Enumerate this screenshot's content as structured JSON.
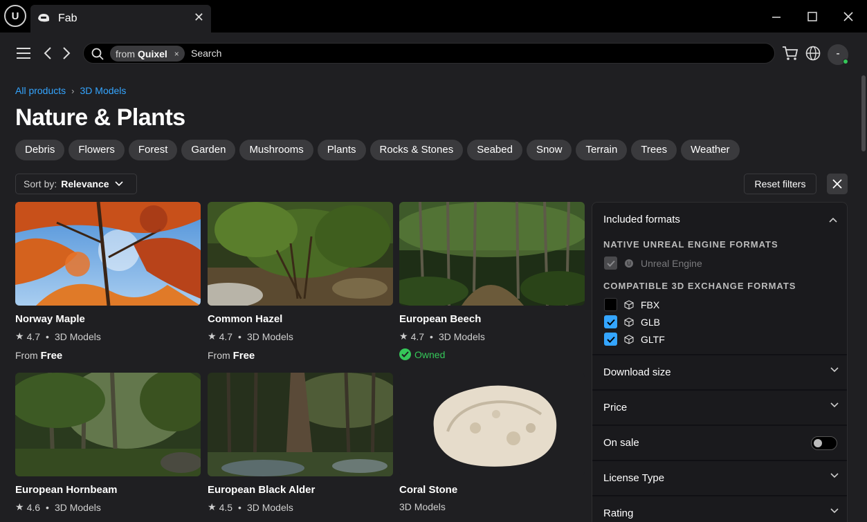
{
  "window": {
    "logo": "U",
    "tab_title": "Fab",
    "tab_close": "✕",
    "minimize": "minimize-icon",
    "maximize": "maximize-icon",
    "close": "close-icon"
  },
  "navbar": {
    "chip_prefix": "from",
    "chip_value": "Quixel",
    "chip_remove": "×",
    "search_placeholder": "Search",
    "avatar": "-"
  },
  "breadcrumb": [
    "All products",
    "3D Models"
  ],
  "page_title": "Nature & Plants",
  "categories": [
    "Debris",
    "Flowers",
    "Forest",
    "Garden",
    "Mushrooms",
    "Plants",
    "Rocks & Stones",
    "Seabed",
    "Snow",
    "Terrain",
    "Trees",
    "Weather"
  ],
  "sort": {
    "label": "Sort by:",
    "value": "Relevance"
  },
  "reset_filters": "Reset filters",
  "products": [
    {
      "title": "Norway Maple",
      "rating": "4.7",
      "type": "3D Models",
      "price_prefix": "From",
      "price": "Free"
    },
    {
      "title": "Common Hazel",
      "rating": "4.7",
      "type": "3D Models",
      "price_prefix": "From",
      "price": "Free"
    },
    {
      "title": "European Beech",
      "rating": "4.7",
      "type": "3D Models",
      "status": "Owned"
    },
    {
      "title": "European Hornbeam",
      "rating": "4.6",
      "type": "3D Models"
    },
    {
      "title": "European Black Alder",
      "rating": "4.5",
      "type": "3D Models"
    },
    {
      "title": "Coral Stone",
      "type": "3D Models"
    }
  ],
  "filters": {
    "included_formats": "Included formats",
    "native_heading": "NATIVE UNREAL ENGINE FORMATS",
    "native_items": [
      {
        "label": "Unreal Engine",
        "checked": true,
        "disabled": true
      }
    ],
    "compatible_heading": "COMPATIBLE 3D EXCHANGE FORMATS",
    "compatible_items": [
      {
        "label": "FBX",
        "checked": false
      },
      {
        "label": "GLB",
        "checked": true
      },
      {
        "label": "GLTF",
        "checked": true
      }
    ],
    "sections": [
      "Download size",
      "Price",
      "On sale",
      "License Type",
      "Rating"
    ],
    "on_sale_enabled": false
  },
  "colors": {
    "accent": "#34a5ff",
    "success": "#35c759",
    "surface": "#1f1f22",
    "chip": "#3a3a3d"
  }
}
